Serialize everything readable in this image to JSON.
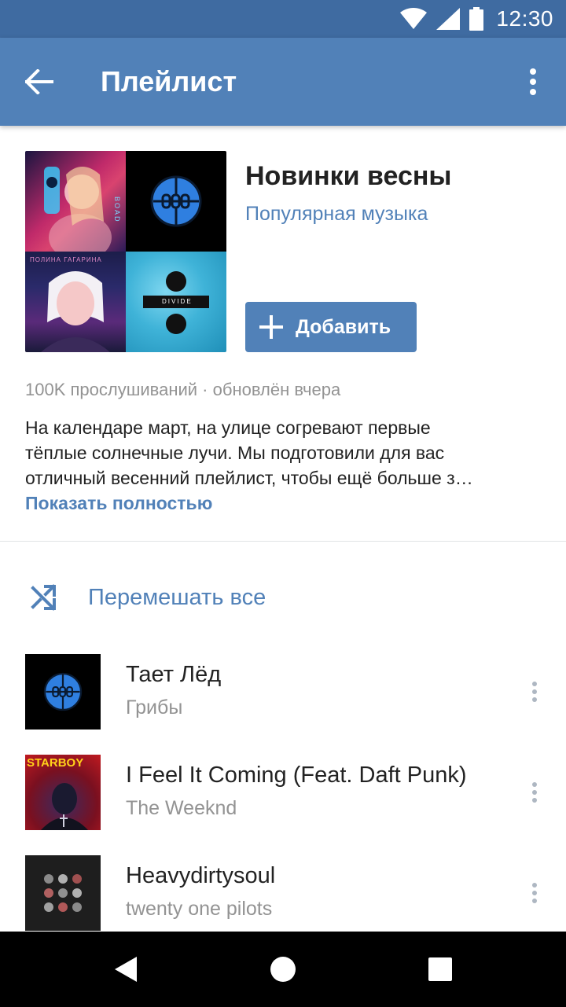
{
  "status_bar": {
    "time": "12:30",
    "icons": [
      "wifi-icon",
      "signal-icon",
      "battery-icon"
    ]
  },
  "app_bar": {
    "title": "Плейлист",
    "back_icon": "arrow-left-icon",
    "more_icon": "more-vertical-icon"
  },
  "playlist": {
    "title": "Новинки весны",
    "subtitle": "Популярная музыка",
    "add_label": "Добавить",
    "cover_texts": {
      "tile1": "BOAD",
      "tile3_top": "ПОЛИНА ГАГАРИНА",
      "tile4": "DIVIDE"
    },
    "stats": "100K прослушиваний · обновлён вчера",
    "description_lines": [
      "На календаре март, на улице согревают первые",
      "тёплые солнечные лучи. Мы подготовили для вас",
      "отличный весенний плейлист, чтобы ещё больше з…"
    ],
    "show_more": "Показать полностью"
  },
  "shuffle": {
    "label": "Перемешать все",
    "icon": "shuffle-icon"
  },
  "tracks": [
    {
      "title": "Тает Лёд",
      "artist": "Грибы"
    },
    {
      "title": "I Feel It Coming (Feat. Daft Punk)",
      "artist": "The Weeknd",
      "art_text": "STARBOY"
    },
    {
      "title": "Heavydirtysoul",
      "artist": "twenty one pilots"
    }
  ],
  "colors": {
    "accent": "#5181b8",
    "status_bar": "#3f6ba1",
    "text": "#222222",
    "secondary": "#939393"
  }
}
